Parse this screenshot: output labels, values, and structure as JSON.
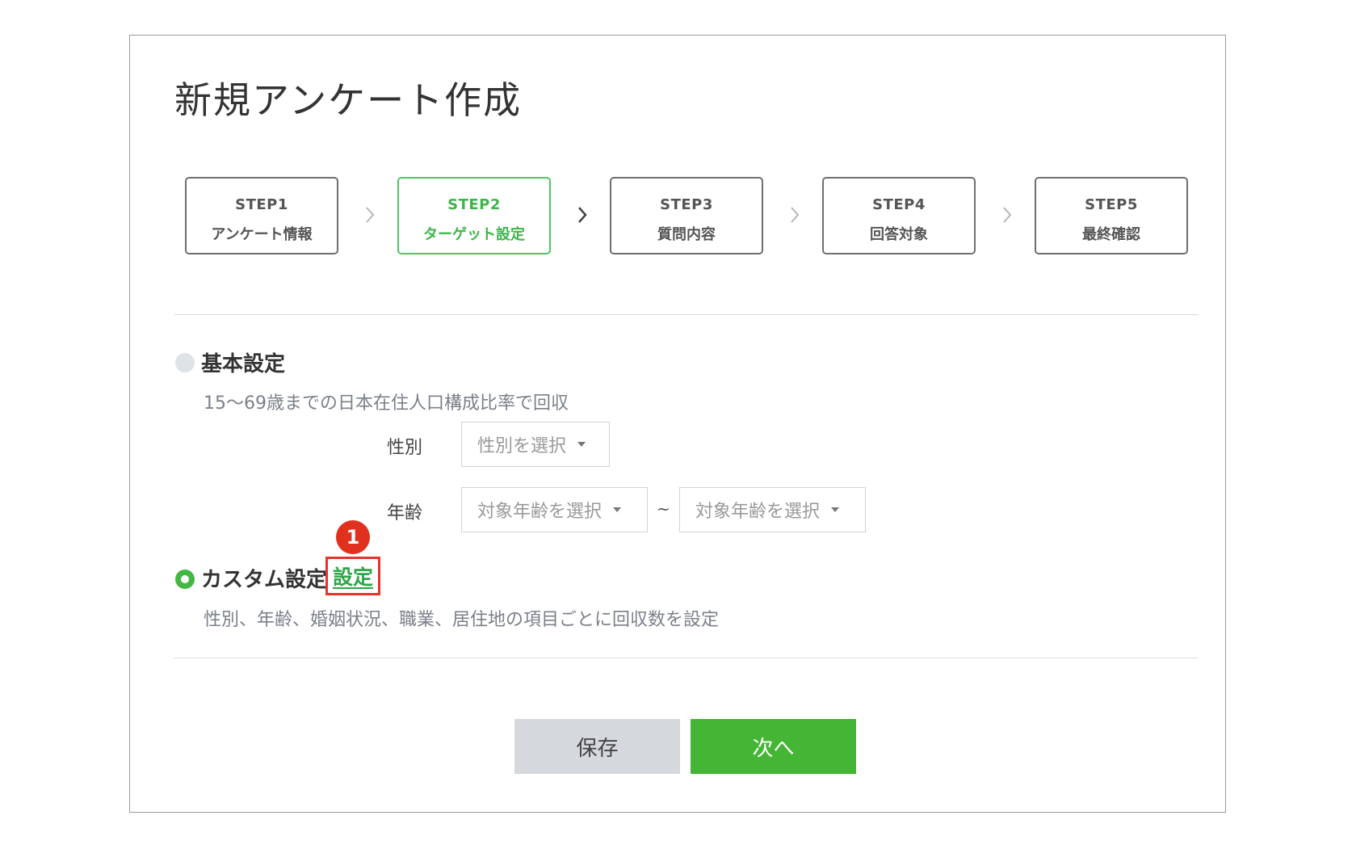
{
  "page": {
    "title": "新規アンケート作成"
  },
  "steps": [
    {
      "num": "STEP1",
      "name": "アンケート情報",
      "active": false
    },
    {
      "num": "STEP2",
      "name": "ターゲット設定",
      "active": true
    },
    {
      "num": "STEP3",
      "name": "質問内容",
      "active": false
    },
    {
      "num": "STEP4",
      "name": "回答対象",
      "active": false
    },
    {
      "num": "STEP5",
      "name": "最終確認",
      "active": false
    }
  ],
  "basic": {
    "title": "基本設定",
    "selected": false,
    "description": "15〜69歳までの日本在住人口構成比率で回収",
    "gender_label": "性別",
    "gender_placeholder": "性別を選択",
    "age_label": "年齢",
    "age_from_placeholder": "対象年齢を選択",
    "age_separator": "~",
    "age_to_placeholder": "対象年齢を選択"
  },
  "custom": {
    "title": "カスタム設定",
    "selected": true,
    "link_label": "設定",
    "description": "性別、年齢、婚姻状況、職業、居住地の項目ごとに回収数を設定"
  },
  "annotation": {
    "marker": "1"
  },
  "buttons": {
    "save": "保存",
    "next": "次へ"
  },
  "colors": {
    "accent": "#3db54a",
    "next_button": "#45b535",
    "save_button": "#d5d8dc",
    "highlight_box": "#e8322a"
  }
}
